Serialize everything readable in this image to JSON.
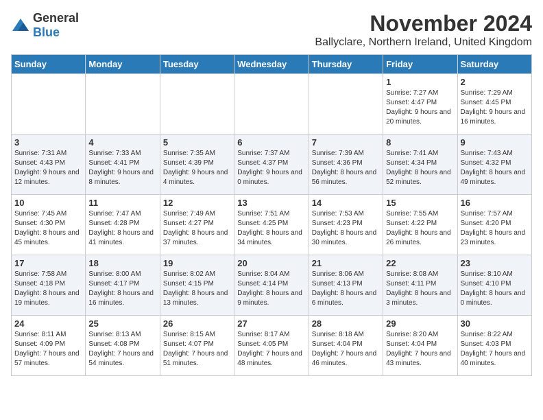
{
  "logo": {
    "general": "General",
    "blue": "Blue"
  },
  "title": "November 2024",
  "location": "Ballyclare, Northern Ireland, United Kingdom",
  "days_of_week": [
    "Sunday",
    "Monday",
    "Tuesday",
    "Wednesday",
    "Thursday",
    "Friday",
    "Saturday"
  ],
  "weeks": [
    [
      {
        "day": "",
        "info": ""
      },
      {
        "day": "",
        "info": ""
      },
      {
        "day": "",
        "info": ""
      },
      {
        "day": "",
        "info": ""
      },
      {
        "day": "",
        "info": ""
      },
      {
        "day": "1",
        "info": "Sunrise: 7:27 AM\nSunset: 4:47 PM\nDaylight: 9 hours and 20 minutes."
      },
      {
        "day": "2",
        "info": "Sunrise: 7:29 AM\nSunset: 4:45 PM\nDaylight: 9 hours and 16 minutes."
      }
    ],
    [
      {
        "day": "3",
        "info": "Sunrise: 7:31 AM\nSunset: 4:43 PM\nDaylight: 9 hours and 12 minutes."
      },
      {
        "day": "4",
        "info": "Sunrise: 7:33 AM\nSunset: 4:41 PM\nDaylight: 9 hours and 8 minutes."
      },
      {
        "day": "5",
        "info": "Sunrise: 7:35 AM\nSunset: 4:39 PM\nDaylight: 9 hours and 4 minutes."
      },
      {
        "day": "6",
        "info": "Sunrise: 7:37 AM\nSunset: 4:37 PM\nDaylight: 9 hours and 0 minutes."
      },
      {
        "day": "7",
        "info": "Sunrise: 7:39 AM\nSunset: 4:36 PM\nDaylight: 8 hours and 56 minutes."
      },
      {
        "day": "8",
        "info": "Sunrise: 7:41 AM\nSunset: 4:34 PM\nDaylight: 8 hours and 52 minutes."
      },
      {
        "day": "9",
        "info": "Sunrise: 7:43 AM\nSunset: 4:32 PM\nDaylight: 8 hours and 49 minutes."
      }
    ],
    [
      {
        "day": "10",
        "info": "Sunrise: 7:45 AM\nSunset: 4:30 PM\nDaylight: 8 hours and 45 minutes."
      },
      {
        "day": "11",
        "info": "Sunrise: 7:47 AM\nSunset: 4:28 PM\nDaylight: 8 hours and 41 minutes."
      },
      {
        "day": "12",
        "info": "Sunrise: 7:49 AM\nSunset: 4:27 PM\nDaylight: 8 hours and 37 minutes."
      },
      {
        "day": "13",
        "info": "Sunrise: 7:51 AM\nSunset: 4:25 PM\nDaylight: 8 hours and 34 minutes."
      },
      {
        "day": "14",
        "info": "Sunrise: 7:53 AM\nSunset: 4:23 PM\nDaylight: 8 hours and 30 minutes."
      },
      {
        "day": "15",
        "info": "Sunrise: 7:55 AM\nSunset: 4:22 PM\nDaylight: 8 hours and 26 minutes."
      },
      {
        "day": "16",
        "info": "Sunrise: 7:57 AM\nSunset: 4:20 PM\nDaylight: 8 hours and 23 minutes."
      }
    ],
    [
      {
        "day": "17",
        "info": "Sunrise: 7:58 AM\nSunset: 4:18 PM\nDaylight: 8 hours and 19 minutes."
      },
      {
        "day": "18",
        "info": "Sunrise: 8:00 AM\nSunset: 4:17 PM\nDaylight: 8 hours and 16 minutes."
      },
      {
        "day": "19",
        "info": "Sunrise: 8:02 AM\nSunset: 4:15 PM\nDaylight: 8 hours and 13 minutes."
      },
      {
        "day": "20",
        "info": "Sunrise: 8:04 AM\nSunset: 4:14 PM\nDaylight: 8 hours and 9 minutes."
      },
      {
        "day": "21",
        "info": "Sunrise: 8:06 AM\nSunset: 4:13 PM\nDaylight: 8 hours and 6 minutes."
      },
      {
        "day": "22",
        "info": "Sunrise: 8:08 AM\nSunset: 4:11 PM\nDaylight: 8 hours and 3 minutes."
      },
      {
        "day": "23",
        "info": "Sunrise: 8:10 AM\nSunset: 4:10 PM\nDaylight: 8 hours and 0 minutes."
      }
    ],
    [
      {
        "day": "24",
        "info": "Sunrise: 8:11 AM\nSunset: 4:09 PM\nDaylight: 7 hours and 57 minutes."
      },
      {
        "day": "25",
        "info": "Sunrise: 8:13 AM\nSunset: 4:08 PM\nDaylight: 7 hours and 54 minutes."
      },
      {
        "day": "26",
        "info": "Sunrise: 8:15 AM\nSunset: 4:07 PM\nDaylight: 7 hours and 51 minutes."
      },
      {
        "day": "27",
        "info": "Sunrise: 8:17 AM\nSunset: 4:05 PM\nDaylight: 7 hours and 48 minutes."
      },
      {
        "day": "28",
        "info": "Sunrise: 8:18 AM\nSunset: 4:04 PM\nDaylight: 7 hours and 46 minutes."
      },
      {
        "day": "29",
        "info": "Sunrise: 8:20 AM\nSunset: 4:04 PM\nDaylight: 7 hours and 43 minutes."
      },
      {
        "day": "30",
        "info": "Sunrise: 8:22 AM\nSunset: 4:03 PM\nDaylight: 7 hours and 40 minutes."
      }
    ]
  ]
}
